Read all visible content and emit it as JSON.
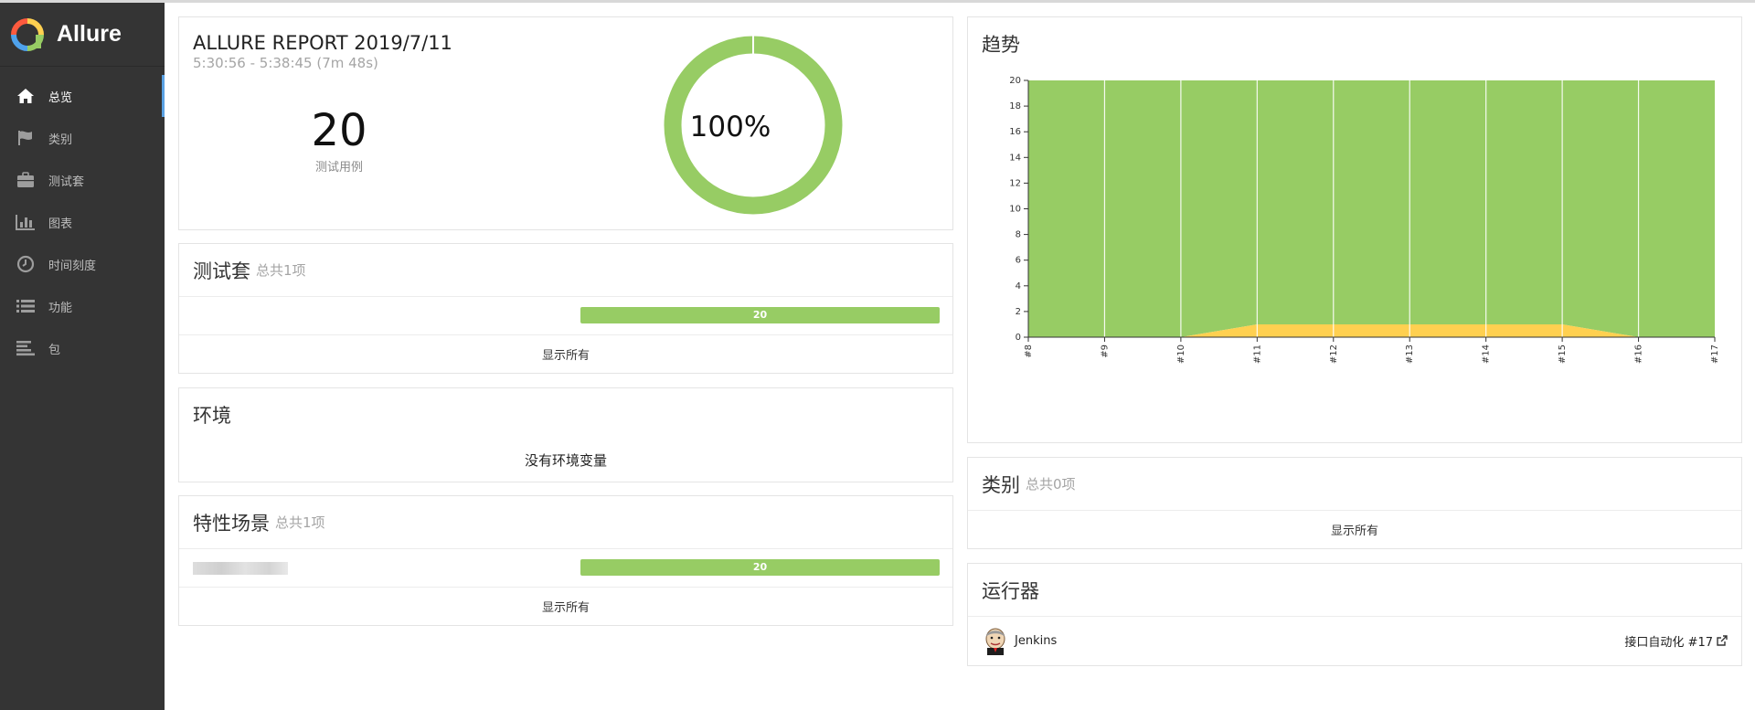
{
  "app": {
    "title": "Allure"
  },
  "sidebar": {
    "items": [
      {
        "label": "总览",
        "icon": "home-icon"
      },
      {
        "label": "类别",
        "icon": "flag-icon"
      },
      {
        "label": "测试套",
        "icon": "briefcase-icon"
      },
      {
        "label": "图表",
        "icon": "bar-chart-icon"
      },
      {
        "label": "时间刻度",
        "icon": "clock-icon"
      },
      {
        "label": "功能",
        "icon": "list-icon"
      },
      {
        "label": "包",
        "icon": "align-left-icon"
      }
    ]
  },
  "summary": {
    "title": "ALLURE REPORT 2019/7/11",
    "time": "5:30:56 - 5:38:45 (7m 48s)",
    "count": "20",
    "count_label": "测试用例",
    "percent": "100%",
    "pass_ratio": 1.0
  },
  "suites": {
    "title": "测试套",
    "subtitle": "总共1项",
    "bar_value": "20",
    "show_all": "显示所有"
  },
  "environment": {
    "title": "环境",
    "empty": "没有环境变量"
  },
  "features": {
    "title": "特性场景",
    "subtitle": "总共1项",
    "bar_value": "20",
    "show_all": "显示所有"
  },
  "trend": {
    "title": "趋势"
  },
  "categories": {
    "title": "类别",
    "subtitle": "总共0项",
    "show_all": "显示所有"
  },
  "executors": {
    "title": "运行器",
    "name": "Jenkins",
    "build": "接口自动化 #17"
  },
  "colors": {
    "passed": "#97cc64",
    "broken": "#ffd050",
    "accent": "#5aa1e3"
  },
  "chart_data": {
    "type": "area",
    "x": [
      "#8",
      "#9",
      "#10",
      "#11",
      "#12",
      "#13",
      "#14",
      "#15",
      "#16",
      "#17"
    ],
    "series": [
      {
        "values": [
          0,
          0,
          0,
          1,
          1,
          1,
          1,
          1,
          0,
          0
        ]
      },
      {
        "values": [
          20,
          20,
          20,
          19,
          19,
          19,
          19,
          19,
          20,
          20
        ]
      }
    ],
    "stacked": true,
    "yticks": [
      "0",
      "2",
      "4",
      "6",
      "8",
      "10",
      "12",
      "14",
      "16",
      "18",
      "20"
    ],
    "ylim": [
      0,
      20
    ],
    "grid": true
  }
}
